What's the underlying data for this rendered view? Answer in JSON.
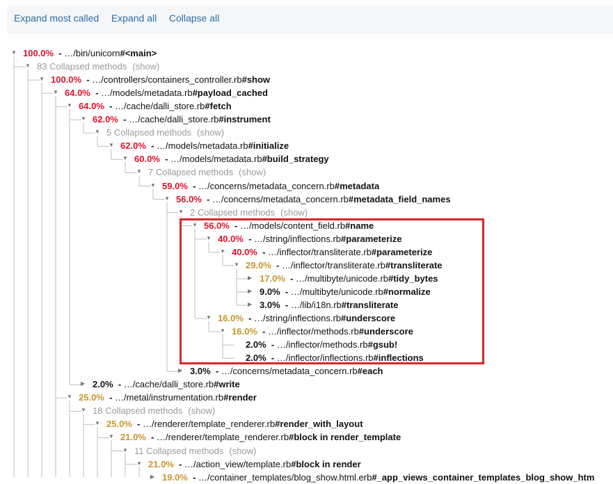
{
  "toolbar": {
    "expand_most_called": "Expand most called",
    "expand_all": "Expand all",
    "collapse_all": "Collapse all"
  },
  "colors": {
    "hot": "#e0102c",
    "warm": "#c7952f",
    "cool": "#111111",
    "highlight": "#d6272a",
    "link": "#2b6ea8"
  },
  "tree": [
    {
      "type": "node",
      "level": 0,
      "pct": "100.0%",
      "heat": "hot",
      "path": "…/bin/unicorn",
      "method": "#<main>",
      "toggle": "expanded"
    },
    {
      "type": "collapsed",
      "level": 1,
      "text": "83 Collapsed methods",
      "show": "(show)",
      "toggle": "expanded"
    },
    {
      "type": "node",
      "level": 2,
      "pct": "100.0%",
      "heat": "hot",
      "path": "…/controllers/containers_controller.rb",
      "method": "#show",
      "toggle": "expanded"
    },
    {
      "type": "node",
      "level": 3,
      "pct": "64.0%",
      "heat": "hot",
      "path": "…/models/metadata.rb",
      "method": "#payload_cached",
      "toggle": "expanded"
    },
    {
      "type": "node",
      "level": 4,
      "pct": "64.0%",
      "heat": "hot",
      "path": "…/cache/dalli_store.rb",
      "method": "#fetch",
      "toggle": "expanded"
    },
    {
      "type": "node",
      "level": 5,
      "pct": "62.0%",
      "heat": "hot",
      "path": "…/cache/dalli_store.rb",
      "method": "#instrument",
      "toggle": "expanded"
    },
    {
      "type": "collapsed",
      "level": 6,
      "text": "5 Collapsed methods",
      "show": "(show)",
      "toggle": "expanded"
    },
    {
      "type": "node",
      "level": 7,
      "pct": "62.0%",
      "heat": "hot",
      "path": "…/models/metadata.rb",
      "method": "#initialize",
      "toggle": "expanded"
    },
    {
      "type": "node",
      "level": 8,
      "pct": "60.0%",
      "heat": "hot",
      "path": "…/models/metadata.rb",
      "method": "#build_strategy",
      "toggle": "expanded"
    },
    {
      "type": "collapsed",
      "level": 9,
      "text": "7 Collapsed methods",
      "show": "(show)",
      "toggle": "expanded"
    },
    {
      "type": "node",
      "level": 10,
      "pct": "59.0%",
      "heat": "hot",
      "path": "…/concerns/metadata_concern.rb",
      "method": "#metadata",
      "toggle": "expanded"
    },
    {
      "type": "node",
      "level": 11,
      "pct": "56.0%",
      "heat": "hot",
      "path": "…/concerns/metadata_concern.rb",
      "method": "#metadata_field_names",
      "toggle": "expanded"
    },
    {
      "type": "collapsed",
      "level": 12,
      "text": "2 Collapsed methods",
      "show": "(show)",
      "toggle": "expanded"
    },
    {
      "type": "node",
      "level": 13,
      "pct": "56.0%",
      "heat": "hot",
      "path": "…/models/content_field.rb",
      "method": "#name",
      "toggle": "expanded"
    },
    {
      "type": "node",
      "level": 14,
      "pct": "40.0%",
      "heat": "hot",
      "path": "…/string/inflections.rb",
      "method": "#parameterize",
      "toggle": "expanded"
    },
    {
      "type": "node",
      "level": 15,
      "pct": "40.0%",
      "heat": "hot",
      "path": "…/inflector/transliterate.rb",
      "method": "#parameterize",
      "toggle": "expanded"
    },
    {
      "type": "node",
      "level": 16,
      "pct": "29.0%",
      "heat": "warm",
      "path": "…/inflector/transliterate.rb",
      "method": "#transliterate",
      "toggle": "expanded"
    },
    {
      "type": "node",
      "level": 17,
      "pct": "17.0%",
      "heat": "warm",
      "path": "…/multibyte/unicode.rb",
      "method": "#tidy_bytes",
      "toggle": "collapsed"
    },
    {
      "type": "node",
      "level": 17,
      "pct": "9.0%",
      "heat": "cool",
      "path": "…/multibyte/unicode.rb",
      "method": "#normalize",
      "toggle": "collapsed"
    },
    {
      "type": "node",
      "level": 17,
      "pct": "3.0%",
      "heat": "cool",
      "path": "…/lib/i18n.rb",
      "method": "#transliterate",
      "toggle": "collapsed"
    },
    {
      "type": "node",
      "level": 14,
      "pct": "16.0%",
      "heat": "warm",
      "path": "…/string/inflections.rb",
      "method": "#underscore",
      "toggle": "expanded"
    },
    {
      "type": "node",
      "level": 15,
      "pct": "16.0%",
      "heat": "warm",
      "path": "…/inflector/methods.rb",
      "method": "#underscore",
      "toggle": "expanded"
    },
    {
      "type": "node",
      "level": 16,
      "pct": "2.0%",
      "heat": "cool",
      "path": "…/inflector/methods.rb",
      "method": "#gsub!",
      "toggle": "leaf"
    },
    {
      "type": "node",
      "level": 16,
      "pct": "2.0%",
      "heat": "cool",
      "path": "…/inflector/inflections.rb",
      "method": "#inflections",
      "toggle": "leaf"
    },
    {
      "type": "node",
      "level": 12,
      "pct": "3.0%",
      "heat": "cool",
      "path": "…/concerns/metadata_concern.rb",
      "method": "#each",
      "toggle": "collapsed"
    },
    {
      "type": "node",
      "level": 5,
      "pct": "2.0%",
      "heat": "cool",
      "path": "…/cache/dalli_store.rb",
      "method": "#write",
      "toggle": "collapsed"
    },
    {
      "type": "node",
      "level": 4,
      "pct": "25.0%",
      "heat": "warm",
      "path": "…/metal/instrumentation.rb",
      "method": "#render",
      "toggle": "expanded"
    },
    {
      "type": "collapsed",
      "level": 5,
      "text": "18 Collapsed methods",
      "show": "(show)",
      "toggle": "expanded"
    },
    {
      "type": "node",
      "level": 6,
      "pct": "25.0%",
      "heat": "warm",
      "path": "…/renderer/template_renderer.rb",
      "method": "#render_with_layout",
      "toggle": "expanded"
    },
    {
      "type": "node",
      "level": 7,
      "pct": "21.0%",
      "heat": "warm",
      "path": "…/renderer/template_renderer.rb",
      "method": "#block in render_template",
      "toggle": "expanded"
    },
    {
      "type": "collapsed",
      "level": 8,
      "text": "11 Collapsed methods",
      "show": "(show)",
      "toggle": "expanded"
    },
    {
      "type": "node",
      "level": 9,
      "pct": "21.0%",
      "heat": "warm",
      "path": "…/action_view/template.rb",
      "method": "#block in render",
      "toggle": "expanded"
    },
    {
      "type": "node",
      "level": 10,
      "pct": "19.0%",
      "heat": "warm",
      "path": "…/container_templates/blog_show.html.erb",
      "method": "#_app_views_container_templates_blog_show_htm",
      "toggle": "collapsed"
    }
  ]
}
